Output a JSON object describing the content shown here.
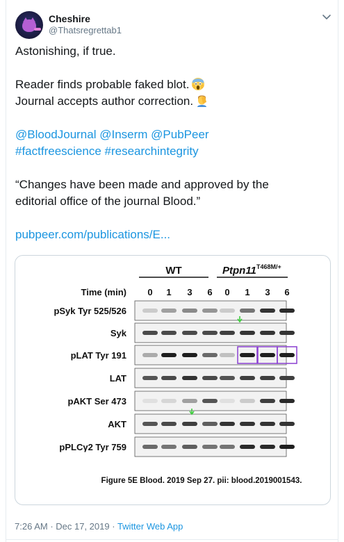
{
  "user": {
    "display_name": "Cheshire",
    "handle": "@Thatsregrettab1"
  },
  "tweet": {
    "line1": "Astonishing, if true.",
    "line2": "Reader finds probable faked blot.",
    "line3": "Journal accepts author correction.",
    "mentions": "@BloodJournal @Inserm @PubPeer",
    "hashtags": "#factfreescience #researchintegrity",
    "quote_line1": "“Changes have been made and approved by the",
    "quote_line2": "editorial office of the journal Blood.”",
    "link": "pubpeer.com/publications/E...",
    "emoji1": "scream-emoji",
    "emoji2": "facepalm-emoji"
  },
  "figure": {
    "group_wt": "WT",
    "group_mut": "Ptpn11",
    "group_mut_sup": "T468M/+",
    "time_label": "Time (min)",
    "timepoints": [
      "0",
      "1",
      "3",
      "6",
      "0",
      "1",
      "3",
      "6"
    ],
    "rows": [
      "pSyk Tyr 525/526",
      "Syk",
      "pLAT Tyr 191",
      "LAT",
      "pAKT Ser 473",
      "AKT",
      "pPLCγ2 Tyr 759"
    ],
    "caption": "Figure 5E Blood. 2019 Sep 27. pii: blood.2019001543.",
    "highlight_color": "#8a3fd1",
    "arrow_color": "#3fcc3f"
  },
  "footer": {
    "time": "7:26 AM",
    "sep1": " · ",
    "date": "Dec 17, 2019",
    "sep2": " · ",
    "source": "Twitter Web App"
  }
}
